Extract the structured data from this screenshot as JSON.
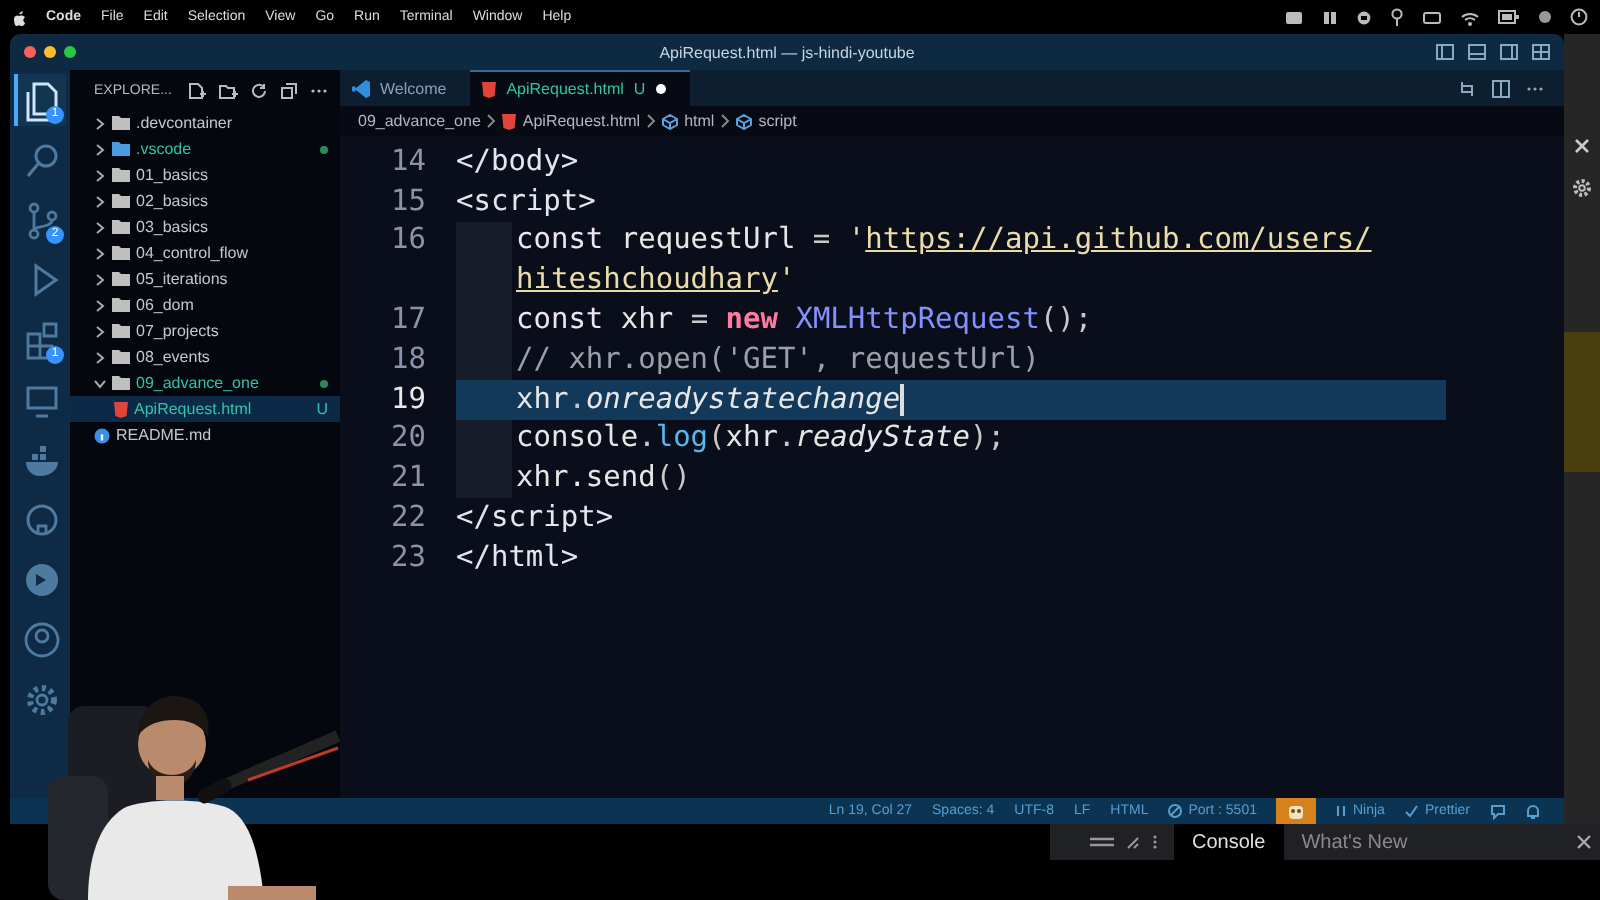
{
  "menu_bar": {
    "items": [
      "Code",
      "File",
      "Edit",
      "Selection",
      "View",
      "Go",
      "Run",
      "Terminal",
      "Window",
      "Help"
    ]
  },
  "window": {
    "title": "ApiRequest.html — js-hindi-youtube"
  },
  "activity_bar": [
    {
      "kind": "files",
      "selected": true,
      "badge": "1"
    },
    {
      "kind": "search",
      "selected": false
    },
    {
      "kind": "source-control",
      "selected": false,
      "badge": "2"
    },
    {
      "kind": "run",
      "selected": false
    },
    {
      "kind": "extensions",
      "selected": false,
      "badge": "1"
    },
    {
      "kind": "remote",
      "selected": false
    },
    {
      "kind": "docker",
      "selected": false
    },
    {
      "kind": "github",
      "selected": false
    },
    {
      "kind": "live-share",
      "selected": false
    },
    {
      "kind": "account",
      "selected": false
    },
    {
      "kind": "settings",
      "selected": false
    }
  ],
  "sidebar": {
    "title": "EXPLORE...",
    "tree": [
      {
        "label": ".devcontainer",
        "kind": "folder",
        "expanded": false,
        "modified": false,
        "selected": false
      },
      {
        "label": ".vscode",
        "kind": "folder",
        "expanded": false,
        "modified": true,
        "selected": false
      },
      {
        "label": "01_basics",
        "kind": "folder",
        "expanded": false,
        "modified": false,
        "selected": false
      },
      {
        "label": "02_basics",
        "kind": "folder",
        "expanded": false,
        "modified": false,
        "selected": false
      },
      {
        "label": "03_basics",
        "kind": "folder",
        "expanded": false,
        "modified": false,
        "selected": false
      },
      {
        "label": "04_control_flow",
        "kind": "folder",
        "expanded": false,
        "modified": false,
        "selected": false
      },
      {
        "label": "05_iterations",
        "kind": "folder",
        "expanded": false,
        "modified": false,
        "selected": false
      },
      {
        "label": "06_dom",
        "kind": "folder",
        "expanded": false,
        "modified": false,
        "selected": false
      },
      {
        "label": "07_projects",
        "kind": "folder",
        "expanded": false,
        "modified": false,
        "selected": false
      },
      {
        "label": "08_events",
        "kind": "folder",
        "expanded": false,
        "modified": false,
        "selected": false
      },
      {
        "label": "09_advance_one",
        "kind": "folder",
        "expanded": true,
        "modified": true,
        "selected": false,
        "children": [
          {
            "label": "ApiRequest.html",
            "kind": "html",
            "modified": true,
            "selected": true,
            "badge": "U"
          }
        ]
      },
      {
        "label": "README.md",
        "kind": "info",
        "modified": false,
        "selected": false
      }
    ]
  },
  "tabs": [
    {
      "label": "Welcome",
      "kind": "vscode",
      "selected": false,
      "dirty": false
    },
    {
      "label": "ApiRequest.html",
      "kind": "html",
      "selected": true,
      "badge": "U",
      "dirty": true
    }
  ],
  "breadcrumb": [
    {
      "label": "09_advance_one",
      "kind": "folder"
    },
    {
      "label": "ApiRequest.html",
      "kind": "html"
    },
    {
      "label": "html",
      "kind": "element"
    },
    {
      "label": "script",
      "kind": "element"
    }
  ],
  "code_lines": [
    {
      "number": "14",
      "indented": false,
      "selected": false,
      "tokens": [
        {
          "kind": "tag",
          "text": "</body>"
        }
      ]
    },
    {
      "number": "15",
      "indented": false,
      "selected": false,
      "tokens": [
        {
          "kind": "tag",
          "text": "<script>"
        }
      ]
    },
    {
      "number": "16",
      "indented": true,
      "selected": false,
      "tokens": [
        {
          "kind": "keyword",
          "text": "const"
        },
        {
          "kind": "variable",
          "text": " requestUrl "
        },
        {
          "kind": "punct",
          "text": "= "
        },
        {
          "kind": "string",
          "text": "'"
        },
        {
          "kind": "link",
          "text": "https://api.github.com/users/"
        }
      ]
    },
    {
      "indented": true,
      "selected": false,
      "tokens": [
        {
          "kind": "link",
          "text": "hiteshchoudhary"
        },
        {
          "kind": "string",
          "text": "'"
        }
      ]
    },
    {
      "number": "17",
      "indented": true,
      "selected": false,
      "tokens": [
        {
          "kind": "keyword",
          "text": "const"
        },
        {
          "kind": "variable",
          "text": " xhr "
        },
        {
          "kind": "punct",
          "text": "= "
        },
        {
          "kind": "new",
          "text": "new"
        },
        {
          "kind": "class",
          "text": " XMLHttpRequest"
        },
        {
          "kind": "punct",
          "text": "();"
        }
      ]
    },
    {
      "number": "18",
      "indented": true,
      "selected": false,
      "tokens": [
        {
          "kind": "comment",
          "text": "// xhr.open('GET', requestUrl)"
        }
      ]
    },
    {
      "number": "19",
      "indented": true,
      "selected": true,
      "tokens": [
        {
          "kind": "variable",
          "text": "xhr"
        },
        {
          "kind": "punct",
          "text": "."
        },
        {
          "kind": "property",
          "text": "onreadystatechange"
        }
      ]
    },
    {
      "number": "20",
      "indented": true,
      "selected": false,
      "tokens": [
        {
          "kind": "variable",
          "text": "console"
        },
        {
          "kind": "punct",
          "text": "."
        },
        {
          "kind": "function",
          "text": "log"
        },
        {
          "kind": "punct",
          "text": "("
        },
        {
          "kind": "variable",
          "text": "xhr"
        },
        {
          "kind": "punct",
          "text": "."
        },
        {
          "kind": "property",
          "text": "readyState"
        },
        {
          "kind": "punct",
          "text": ");"
        }
      ]
    },
    {
      "number": "21",
      "indented": true,
      "selected": false,
      "tokens": [
        {
          "kind": "variable",
          "text": "xhr.send"
        },
        {
          "kind": "punct",
          "text": "()"
        }
      ]
    },
    {
      "number": "22",
      "indented": false,
      "selected": false,
      "tokens": [
        {
          "kind": "tag",
          "text": "</script>"
        }
      ]
    },
    {
      "number": "23",
      "indented": false,
      "selected": false,
      "tokens": [
        {
          "kind": "tag",
          "text": "</html>"
        }
      ]
    }
  ],
  "status_bar": [
    {
      "kind": "text",
      "text": "Ln 19, Col 27"
    },
    {
      "kind": "text",
      "text": "Spaces: 4"
    },
    {
      "kind": "text",
      "text": "UTF-8"
    },
    {
      "kind": "text",
      "text": "LF"
    },
    {
      "kind": "text",
      "text": "HTML"
    },
    {
      "kind": "port",
      "text": "Port : 5501"
    },
    {
      "kind": "live"
    },
    {
      "kind": "ninja",
      "text": "Ninja"
    },
    {
      "kind": "prettier",
      "text": "Prettier"
    },
    {
      "kind": "feedback"
    },
    {
      "kind": "bell"
    }
  ],
  "devtools": {
    "tabs": [
      {
        "label": "Console",
        "selected": true
      },
      {
        "label": "What's New",
        "selected": false
      }
    ]
  }
}
